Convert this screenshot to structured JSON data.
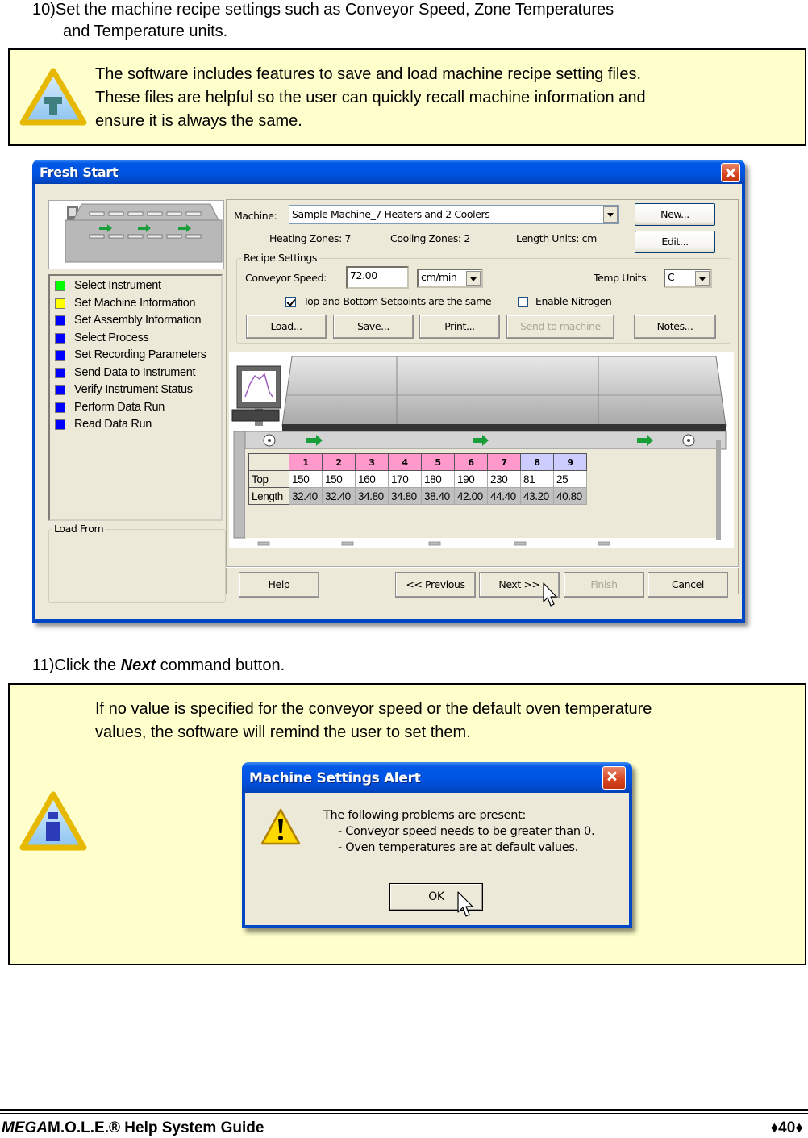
{
  "steps": [
    {
      "number": "10)",
      "text_line1": "Set the machine recipe settings such as Conveyor Speed, Zone Temperatures",
      "text_line2": "and Temperature units."
    },
    {
      "number": "11)",
      "text_pre": "Click the ",
      "text_em": "Next",
      "text_post": " command button."
    }
  ],
  "callouts": [
    {
      "icon": "tip-icon",
      "lines": [
        "The software includes features to save and load machine recipe setting files.",
        "These files are helpful so the user can quickly recall machine information and",
        "ensure it is always the same."
      ]
    },
    {
      "icon": "info-icon",
      "lines": [
        "If no value is specified for the conveyor speed or the default oven temperature",
        "values, the software will remind the user to set them."
      ]
    }
  ],
  "fresh_start": {
    "title": "Fresh Start",
    "steps": [
      {
        "label": "Select Instrument",
        "color": "#00ff00"
      },
      {
        "label": "Set Machine Information",
        "color": "#ffff00"
      },
      {
        "label": "Set Assembly Information",
        "color": "#0000ff"
      },
      {
        "label": "Select Process",
        "color": "#0000ff"
      },
      {
        "label": "Set Recording Parameters",
        "color": "#0000ff"
      },
      {
        "label": "Send Data to Instrument",
        "color": "#0000ff"
      },
      {
        "label": "Verify Instrument Status",
        "color": "#0000ff"
      },
      {
        "label": "Perform Data Run",
        "color": "#0000ff"
      },
      {
        "label": "Read Data Run",
        "color": "#0000ff"
      }
    ],
    "load_from_label": "Load From",
    "machine_label": "Machine:",
    "machine_value": "Sample Machine_7 Heaters and 2 Coolers",
    "new_button": "New...",
    "edit_button": "Edit...",
    "heating_zones": "Heating Zones: 7",
    "cooling_zones": "Cooling Zones: 2",
    "length_units": "Length Units: cm",
    "recipe_settings_label": "Recipe Settings",
    "conveyor_speed_label": "Conveyor Speed:",
    "conveyor_speed_value": "72.00",
    "speed_unit": "cm/min",
    "temp_units_label": "Temp Units:",
    "temp_units_value": "C",
    "same_setpoints_label": "Top and Bottom Setpoints are the same",
    "same_setpoints_checked": true,
    "enable_nitrogen_label": "Enable Nitrogen",
    "enable_nitrogen_checked": false,
    "buttons": {
      "load": "Load...",
      "save": "Save...",
      "print": "Print...",
      "send": "Send to machine",
      "notes": "Notes..."
    },
    "zones": {
      "headers": [
        "1",
        "2",
        "3",
        "4",
        "5",
        "6",
        "7",
        "8",
        "9"
      ],
      "types": [
        "heat",
        "heat",
        "heat",
        "heat",
        "heat",
        "heat",
        "heat",
        "cool",
        "cool"
      ],
      "top_label": "Top",
      "length_label": "Length",
      "top": [
        "150",
        "150",
        "160",
        "170",
        "180",
        "190",
        "230",
        "81",
        "25"
      ],
      "length": [
        "32.40",
        "32.40",
        "34.80",
        "34.80",
        "38.40",
        "42.00",
        "44.40",
        "43.20",
        "40.80"
      ]
    },
    "nav": {
      "help": "Help",
      "previous": "<< Previous",
      "next": "Next >>",
      "finish": "Finish",
      "cancel": "Cancel"
    }
  },
  "alert": {
    "title": "Machine Settings Alert",
    "message_line1": "The following problems are present:",
    "message_line2": "- Conveyor speed needs to be greater than 0.",
    "message_line3": "- Oven temperatures are at default values.",
    "ok_button": "OK"
  },
  "footer": {
    "brand_italic": "MEGA",
    "brand_rest": "M.O.L.E.® Help System Guide",
    "page": "♦40♦"
  }
}
